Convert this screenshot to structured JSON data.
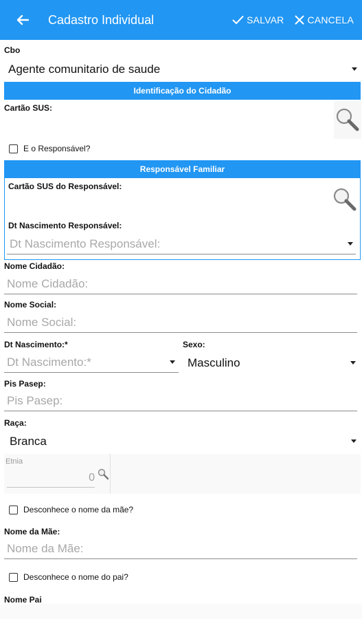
{
  "appbar": {
    "title": "Cadastro Individual",
    "save_label": "SALVAR",
    "cancel_label": "CANCELA",
    "accent_color": "#2196f3"
  },
  "cbo": {
    "label": "Cbo",
    "value": "Agente comunitario de saude"
  },
  "section_cidadao": {
    "title": "Identificação do Cidadão"
  },
  "cartao_sus": {
    "label": "Cartão SUS:"
  },
  "responsavel_check": {
    "label": "E o Responsável?"
  },
  "section_responsavel": {
    "title": "Responsável Familiar"
  },
  "cartao_sus_responsavel": {
    "label": "Cartão SUS do Responsável:"
  },
  "dt_nasc_responsavel": {
    "label": "Dt Nascimento Responsável:",
    "placeholder": "Dt Nascimento Responsável:"
  },
  "nome_cidadao": {
    "label": "Nome Cidadão:",
    "placeholder": "Nome Cidadão:"
  },
  "nome_social": {
    "label": "Nome Social:",
    "placeholder": "Nome Social:"
  },
  "dt_nascimento": {
    "label": "Dt Nascimento:*",
    "placeholder": "Dt Nascimento:*"
  },
  "sexo": {
    "label": "Sexo:",
    "value": "Masculino"
  },
  "pis_pasep": {
    "label": "Pis Pasep:",
    "placeholder": "Pis Pasep:"
  },
  "raca": {
    "label": "Raça:",
    "value": "Branca"
  },
  "etnia": {
    "label": "Etnia",
    "value": "0"
  },
  "desconhece_mae": {
    "label": "Desconhece o nome da mãe?"
  },
  "nome_mae": {
    "label": "Nome da Mãe:",
    "placeholder": "Nome da Mãe:"
  },
  "desconhece_pai": {
    "label": "Desconhece o nome do pai?"
  },
  "nome_pai": {
    "label": "Nome Pai"
  }
}
